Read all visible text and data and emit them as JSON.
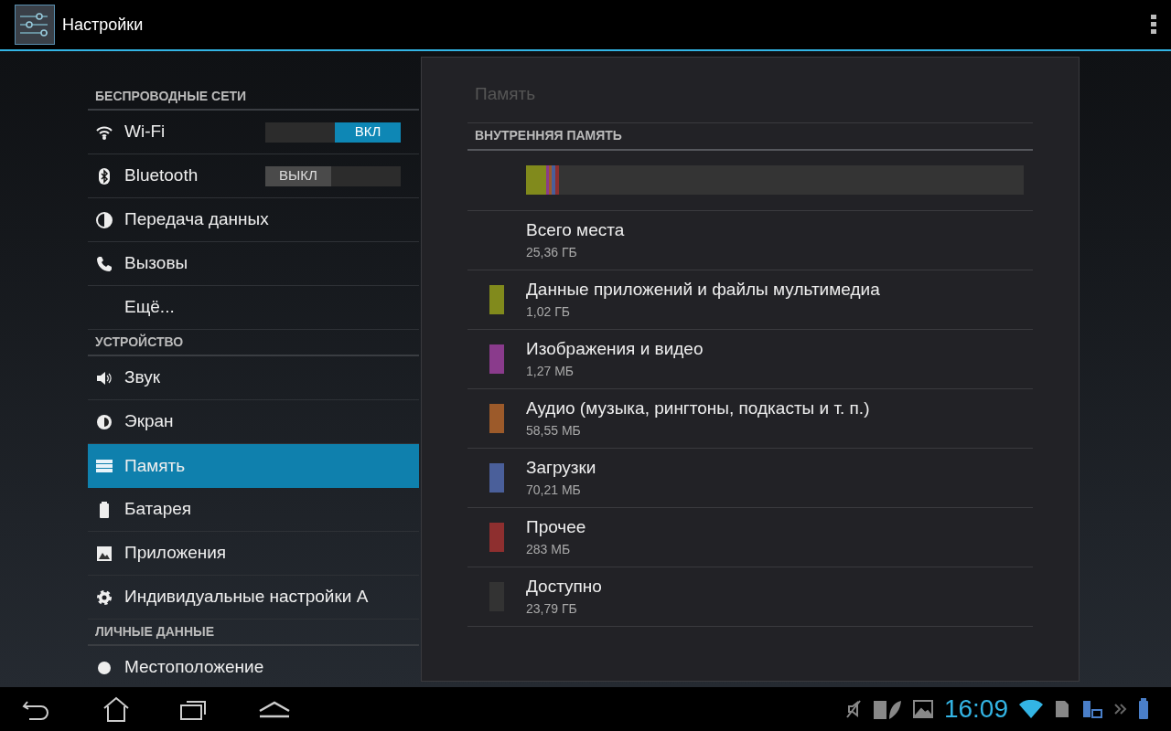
{
  "action_bar": {
    "title": "Настройки"
  },
  "sidebar": {
    "sections": [
      {
        "header": "БЕСПРОВОДНЫЕ СЕТИ",
        "items": [
          {
            "kind": "toggle",
            "label": "Wi-Fi",
            "selected": false,
            "switch": {
              "on": true,
              "label": "ВКЛ"
            }
          },
          {
            "kind": "toggle",
            "label": "Bluetooth",
            "selected": false,
            "switch": {
              "on": false,
              "label": "ВЫКЛ"
            }
          },
          {
            "kind": "plain",
            "label": "Передача данных",
            "selected": false
          },
          {
            "kind": "plain",
            "label": "Вызовы",
            "selected": false
          },
          {
            "kind": "plain",
            "label": "Ещё...",
            "selected": false
          }
        ]
      },
      {
        "header": "УСТРОЙСТВО",
        "items": [
          {
            "kind": "plain",
            "label": "Звук",
            "selected": false
          },
          {
            "kind": "plain",
            "label": "Экран",
            "selected": false
          },
          {
            "kind": "plain",
            "label": "Память",
            "selected": true
          },
          {
            "kind": "plain",
            "label": "Батарея",
            "selected": false
          },
          {
            "kind": "plain",
            "label": "Приложения",
            "selected": false
          },
          {
            "kind": "plain",
            "label": "Индивидуальные настройки А",
            "selected": false
          }
        ]
      },
      {
        "header": "ЛИЧНЫЕ ДАННЫЕ",
        "items": [
          {
            "kind": "plain",
            "label": "Местоположение",
            "selected": false
          }
        ]
      }
    ]
  },
  "panel": {
    "title": "Память",
    "section": "ВНУТРЕННЯЯ ПАМЯТЬ",
    "total": {
      "label": "Всего места",
      "value": "25,36 ГБ"
    },
    "categories": [
      {
        "label": "Данные приложений и файлы мультимедиа",
        "value": "1,02 ГБ",
        "color": "#818a1c",
        "level": 0.04
      },
      {
        "label": "Изображения и видео",
        "value": "1,27 МБ",
        "color": "#8a3b8c",
        "level": 0.004
      },
      {
        "label": "Аудио (музыка, рингтоны, подкасты и т. п.)",
        "value": "58,55 МБ",
        "color": "#9c5a2a",
        "level": 0.006
      },
      {
        "label": "Загрузки",
        "value": "70,21 МБ",
        "color": "#4a5f9a",
        "level": 0.007
      },
      {
        "label": "Прочее",
        "value": "283 МБ",
        "color": "#8e2f2f",
        "level": 0.007
      },
      {
        "label": "Доступно",
        "value": "23,79 ГБ",
        "color": "#333333"
      }
    ]
  },
  "status_bar": {
    "time": "16:09"
  }
}
